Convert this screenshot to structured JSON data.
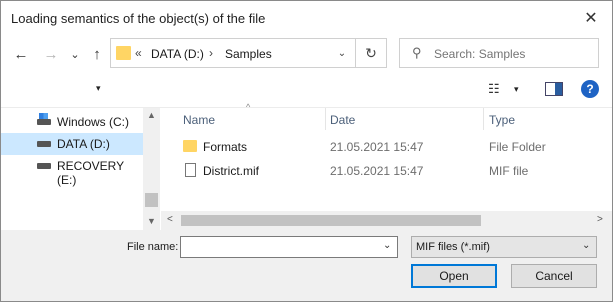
{
  "window": {
    "title": "Loading semantics of the object(s) of the file",
    "close_glyph": "✕"
  },
  "nav": {
    "back_glyph": "←",
    "forward_glyph": "→",
    "recent_glyph": "⌄",
    "up_glyph": "↑",
    "breadcrumb_overflow": "«",
    "breadcrumb": [
      "DATA (D:)",
      "Samples"
    ],
    "breadcrumb_separator": "›",
    "dropdown_glyph": "⌄",
    "refresh_glyph": "↻",
    "search_placeholder": "Search: Samples",
    "search_glyph": "⚲"
  },
  "toolbar": {
    "organize_dropdown_glyph": "▾",
    "view_glyph": "☷",
    "view_dropdown_glyph": "▾",
    "help_label": "?"
  },
  "sidebar": {
    "items": [
      {
        "label": "Windows (C:)",
        "icon": "windows-drive-icon"
      },
      {
        "label": "DATA (D:)",
        "icon": "drive-icon"
      },
      {
        "label": "RECOVERY (E:)",
        "icon": "drive-icon"
      }
    ],
    "selected_index": 1
  },
  "files": {
    "columns": [
      "Name",
      "Date",
      "Type"
    ],
    "sort_glyph": "^",
    "rows": [
      {
        "name": "Formats",
        "date": "21.05.2021 15:47",
        "type": "File Folder",
        "icon": "folder-icon"
      },
      {
        "name": "District.mif",
        "date": "21.05.2021 15:47",
        "type": "MIF file",
        "icon": "file-icon"
      }
    ]
  },
  "scroll": {
    "up_glyph": "▲",
    "down_glyph": "▼",
    "left_glyph": "<",
    "right_glyph": ">"
  },
  "bottom": {
    "filename_label": "File name:",
    "filename_value": "",
    "filename_dropdown_glyph": "⌄",
    "filetype_value": "MIF files (*.mif)",
    "filetype_dropdown_glyph": "⌄",
    "open_label": "Open",
    "cancel_label": "Cancel"
  },
  "colors": {
    "accent": "#0078d7",
    "selection": "#cce8ff",
    "folder": "#ffd564",
    "help": "#1e63c4"
  }
}
